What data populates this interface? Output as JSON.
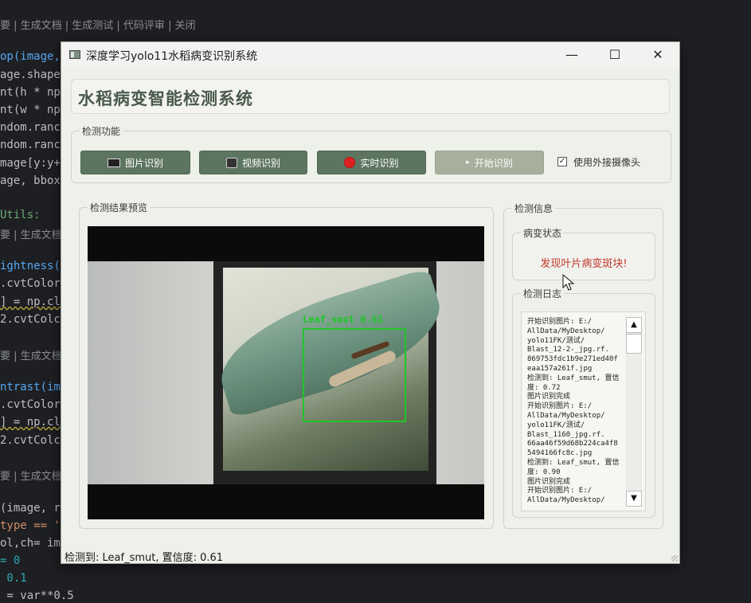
{
  "editor": {
    "codelens": "要 | 生成文档 | 生成测试 | 代码评审 | 关闭",
    "codelens_short": "要 | 生成文档",
    "lines": {
      "l1": "op(image,",
      "l2": "age.shape",
      "l3": "nt(h * np",
      "l4": "nt(w * np",
      "l5": "ndom.ranc",
      "l6": "ndom.ranc",
      "l7": "mage[y:y+",
      "l8": "age, bbox",
      "l9": "Utils:",
      "l10": "ightness(",
      "l11": ".cvtColor",
      "l12": "] = np.cl",
      "l13": "2.cvtColc",
      "l14": "ntrast(im",
      "l15": ".cvtColor",
      "l16": "] = np.cl",
      "l17": "2.cvtColc",
      "l18": "(image, r",
      "l19": "type == '",
      "l20": "ol,ch= im",
      "l21": "= 0",
      "l22": " 0.1",
      "l23": " = var**0.5"
    }
  },
  "window": {
    "title": "深度学习yolo11水稻病变识别系统",
    "controls": {
      "minimize": "—",
      "maximize": "☐",
      "close": "✕"
    }
  },
  "header": {
    "title": "水稻病变智能检测系统"
  },
  "functions": {
    "group_title": "检测功能",
    "image_button": "图片识别",
    "video_button": "视频识别",
    "realtime_button": "实时识别",
    "start_button": "开始识别",
    "external_camera_label": "使用外接摄像头",
    "external_camera_checked": true
  },
  "preview": {
    "group_title": "检测结果预览",
    "detection_label": "Leaf_smut 0.61",
    "box_color": "#22c52a"
  },
  "info": {
    "group_title": "检测信息",
    "status_title": "病变状态",
    "status_text": "发现叶片病变斑块!",
    "status_color": "#c0392b",
    "log_title": "检测日志",
    "log_text": "开始识别图片: E:/\nAllData/MyDesktop/\nyolo11FK/测试/\nBlast_12-2-_jpg.rf.\n869753fdc1b9e271ed40f\neaa157a261f.jpg\n检测到: Leaf_smut, 置信\n度: 0.72\n图片识别完成\n开始识别图片: E:/\nAllData/MyDesktop/\nyolo11FK/测试/\nBlast_1160_jpg.rf.\n66aa46f59d68b224ca4f8\n5494166fc8c.jpg\n检测到: Leaf_smut, 置信\n度: 0.90\n图片识别完成\n开始识别图片: E:/\nAllData/MyDesktop/"
  },
  "statusbar": {
    "text": "检测到: Leaf_smut, 置信度: 0.61"
  },
  "colors": {
    "accent": "#5d7560",
    "disabled": "#a6b09c",
    "window_bg": "#eef0ea"
  }
}
